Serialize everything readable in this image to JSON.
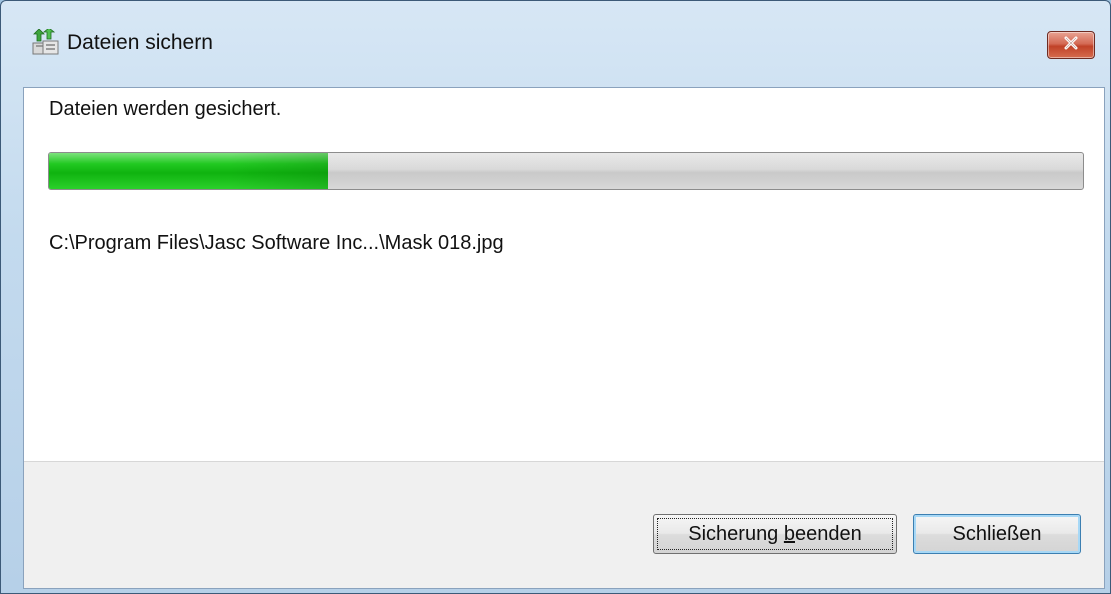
{
  "window": {
    "title": "Dateien sichern",
    "close_icon": "close-icon",
    "app_icon": "backup-files-icon"
  },
  "content": {
    "status_text": "Dateien werden gesichert.",
    "progress_percent": 27,
    "current_file": "C:\\Program Files\\Jasc Software Inc...\\Mask 018.jpg"
  },
  "buttons": {
    "stop_label_pre": "Sicherung ",
    "stop_label_accel": "b",
    "stop_label_post": "eenden",
    "close_label": "Schließen"
  },
  "colors": {
    "progress_fill": "#1bc21b",
    "close_button": "#c8442c",
    "default_button_border": "#3c7fb1"
  }
}
